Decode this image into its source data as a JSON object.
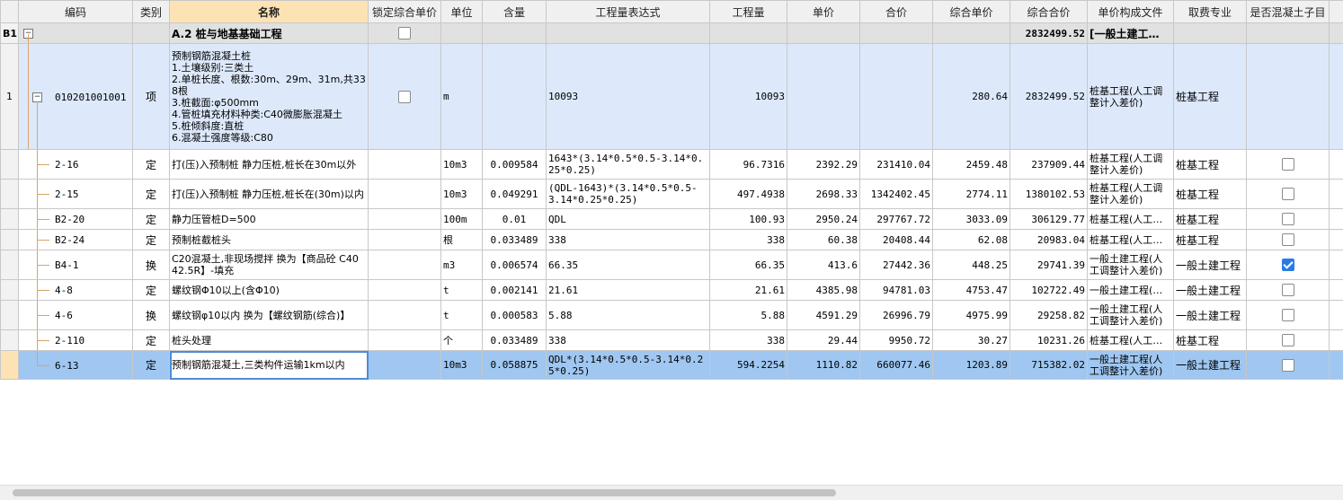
{
  "columns": [
    "",
    "编码",
    "类别",
    "名称",
    "锁定综合单价",
    "单位",
    "含量",
    "工程量表达式",
    "工程量",
    "单价",
    "合价",
    "综合单价",
    "综合合价",
    "单价构成文件",
    "取费专业",
    "是否混凝土子目"
  ],
  "section": {
    "idx": "B1",
    "toggle": "−",
    "name": "A.2   桩与地基基础工程",
    "total": "2832499.52",
    "file": "[一般土建工…"
  },
  "item": {
    "idx": "1",
    "toggle": "−",
    "code": "010201001001",
    "type": "项",
    "name_lines": [
      "预制钢筋混凝土桩",
      "1.土壤级别:三类土",
      "2.单桩长度、根数:30m、29m、31m,共338根",
      "3.桩截面:φ500mm",
      "4.管桩填充材料种类:C40微膨胀混凝土",
      "5.桩倾斜度:直桩",
      "6.混凝土强度等级:C80"
    ],
    "unit": "m",
    "expr": "10093",
    "qty": "10093",
    "comp_price": "280.64",
    "comp_total": "2832499.52",
    "file": "桩基工程(人工调整计入差价)",
    "specialty": "桩基工程"
  },
  "rows": [
    {
      "code": "2-16",
      "type": "定",
      "name": "打(压)入预制桩 静力压桩,桩长在30m以外",
      "unit": "10m3",
      "content": "0.009584",
      "expr": "1643*(3.14*0.5*0.5-3.14*0.25*0.25)",
      "qty": "96.7316",
      "price": "2392.29",
      "total": "231410.04",
      "comp_price": "2459.48",
      "comp_total": "237909.44",
      "file": "桩基工程(人工调整计入差价)",
      "specialty": "桩基工程",
      "concrete": false
    },
    {
      "code": "2-15",
      "type": "定",
      "name": "打(压)入预制桩 静力压桩,桩长在(30m)以内",
      "unit": "10m3",
      "content": "0.049291",
      "expr": "(QDL-1643)*(3.14*0.5*0.5-3.14*0.25*0.25)",
      "qty": "497.4938",
      "price": "2698.33",
      "total": "1342402.45",
      "comp_price": "2774.11",
      "comp_total": "1380102.53",
      "file": "桩基工程(人工调整计入差价)",
      "specialty": "桩基工程",
      "concrete": false
    },
    {
      "code": "B2-20",
      "type": "定",
      "name": "静力压管桩D=500",
      "unit": "100m",
      "content": "0.01",
      "expr": "QDL",
      "qty": "100.93",
      "price": "2950.24",
      "total": "297767.72",
      "comp_price": "3033.09",
      "comp_total": "306129.77",
      "file": "桩基工程(人工…",
      "specialty": "桩基工程",
      "concrete": false
    },
    {
      "code": "B2-24",
      "type": "定",
      "name": "预制桩截桩头",
      "unit": "根",
      "content": "0.033489",
      "expr": "338",
      "qty": "338",
      "price": "60.38",
      "total": "20408.44",
      "comp_price": "62.08",
      "comp_total": "20983.04",
      "file": "桩基工程(人工…",
      "specialty": "桩基工程",
      "concrete": false
    },
    {
      "code": "B4-1",
      "type": "换",
      "name": "C20混凝土,非现场搅拌 换为【商品砼 C40 42.5R】-填充",
      "unit": "m3",
      "content": "0.006574",
      "expr": "66.35",
      "qty": "66.35",
      "price": "413.6",
      "total": "27442.36",
      "comp_price": "448.25",
      "comp_total": "29741.39",
      "file": "一般土建工程(人工调整计入差价)",
      "specialty": "一般土建工程",
      "concrete": true
    },
    {
      "code": "4-8",
      "type": "定",
      "name": "螺纹钢Φ10以上(含Φ10)",
      "unit": "t",
      "content": "0.002141",
      "expr": "21.61",
      "qty": "21.61",
      "price": "4385.98",
      "total": "94781.03",
      "comp_price": "4753.47",
      "comp_total": "102722.49",
      "file": "一般土建工程(…",
      "specialty": "一般土建工程",
      "concrete": false
    },
    {
      "code": "4-6",
      "type": "换",
      "name": "螺纹钢φ10以内 换为【螺纹钢筋(综合)】",
      "unit": "t",
      "content": "0.000583",
      "expr": "5.88",
      "qty": "5.88",
      "price": "4591.29",
      "total": "26996.79",
      "comp_price": "4975.99",
      "comp_total": "29258.82",
      "file": "一般土建工程(人工调整计入差价)",
      "specialty": "一般土建工程",
      "concrete": false
    },
    {
      "code": "2-110",
      "type": "定",
      "name": "桩头处理",
      "unit": "个",
      "content": "0.033489",
      "expr": "338",
      "qty": "338",
      "price": "29.44",
      "total": "9950.72",
      "comp_price": "30.27",
      "comp_total": "10231.26",
      "file": "桩基工程(人工…",
      "specialty": "桩基工程",
      "concrete": false
    },
    {
      "code": "6-13",
      "type": "定",
      "name": "预制钢筋混凝土,三类构件运输1km以内",
      "unit": "10m3",
      "content": "0.058875",
      "expr": "QDL*(3.14*0.5*0.5-3.14*0.25*0.25)",
      "qty": "594.2254",
      "price": "1110.82",
      "total": "660077.46",
      "comp_price": "1203.89",
      "comp_total": "715382.02",
      "file": "一般土建工程(人工调整计入差价)",
      "specialty": "一般土建工程",
      "concrete": false
    }
  ],
  "selected_row": 8,
  "colors": {
    "header_bg": "#f0f0f0",
    "selected_header": "#fde3b4",
    "section_bg": "#e1e1e1",
    "item_bg": "#dde9fb",
    "selected_row": "#9fc7f1",
    "check_on": "#2b7be4",
    "tree_line": "#d8a36a"
  }
}
